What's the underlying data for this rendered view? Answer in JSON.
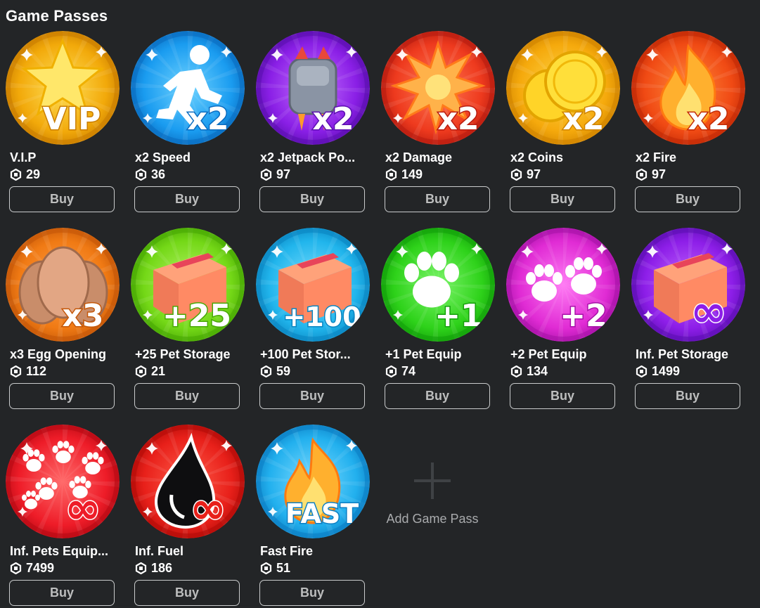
{
  "page": {
    "title": "Game Passes",
    "background": "#232527"
  },
  "passes": [
    {
      "name": "V.I.P",
      "price": "29",
      "buy_label": "Buy",
      "icon": "vip-star-icon",
      "colors": [
        "#ffe15a",
        "#f2a90a",
        "#c97d00"
      ],
      "badge": "VIP"
    },
    {
      "name": "x2 Speed",
      "price": "36",
      "buy_label": "Buy",
      "icon": "running-person-icon",
      "colors": [
        "#6fd3ff",
        "#1a9cf0",
        "#0a6cc0"
      ],
      "badge": "x2"
    },
    {
      "name": "x2 Jetpack Po...",
      "price": "97",
      "buy_label": "Buy",
      "icon": "jetpack-icon",
      "colors": [
        "#c574ff",
        "#8a1fe6",
        "#5b0fb0"
      ],
      "badge": "x2"
    },
    {
      "name": "x2 Damage",
      "price": "149",
      "buy_label": "Buy",
      "icon": "explosion-icon",
      "colors": [
        "#ff7a55",
        "#ee3a1e",
        "#b81c10"
      ],
      "badge": "x2"
    },
    {
      "name": "x2 Coins",
      "price": "97",
      "buy_label": "Buy",
      "icon": "coins-icon",
      "colors": [
        "#ffd84a",
        "#f5a90c",
        "#d08400"
      ],
      "badge": "x2"
    },
    {
      "name": "x2 Fire",
      "price": "97",
      "buy_label": "Buy",
      "icon": "fire-icon",
      "colors": [
        "#ff8a3c",
        "#f04a14",
        "#c22a06"
      ],
      "badge": "x2"
    },
    {
      "name": "x3 Egg Opening",
      "price": "112",
      "buy_label": "Buy",
      "icon": "eggs-icon",
      "colors": [
        "#ffa24d",
        "#f07a14",
        "#c45708"
      ],
      "badge": "x3"
    },
    {
      "name": "+25 Pet Storage",
      "price": "21",
      "buy_label": "Buy",
      "icon": "box-icon",
      "colors": [
        "#b6f56a",
        "#74d817",
        "#48a804"
      ],
      "badge": "+25"
    },
    {
      "name": "+100 Pet Stor...",
      "price": "59",
      "buy_label": "Buy",
      "icon": "box-icon",
      "colors": [
        "#7fe0ff",
        "#21b5ec",
        "#0a86c2"
      ],
      "badge": "+100"
    },
    {
      "name": "+1 Pet Equip",
      "price": "74",
      "buy_label": "Buy",
      "icon": "paw-icon",
      "colors": [
        "#7cf56a",
        "#2ed21a",
        "#13a00a"
      ],
      "badge": "+1"
    },
    {
      "name": "+2 Pet Equip",
      "price": "134",
      "buy_label": "Buy",
      "icon": "paws-icon",
      "colors": [
        "#ff7cf4",
        "#e02bd4",
        "#a812a8"
      ],
      "badge": "+2"
    },
    {
      "name": "Inf. Pet Storage",
      "price": "1499",
      "buy_label": "Buy",
      "icon": "box-icon",
      "colors": [
        "#c46bff",
        "#8d1ee8",
        "#5e0fb4"
      ],
      "badge": "∞"
    },
    {
      "name": "Inf. Pets Equip...",
      "price": "7499",
      "buy_label": "Buy",
      "icon": "many-paws-icon",
      "colors": [
        "#ff6a6a",
        "#ee1c28",
        "#b80a14"
      ],
      "badge": "∞"
    },
    {
      "name": "Inf. Fuel",
      "price": "186",
      "buy_label": "Buy",
      "icon": "oil-drop-icon",
      "colors": [
        "#ff5c4a",
        "#e8201a",
        "#b40c08"
      ],
      "badge": "∞"
    },
    {
      "name": "Fast Fire",
      "price": "51",
      "buy_label": "Buy",
      "icon": "fire-icon",
      "colors": [
        "#7fdcff",
        "#22b0ee",
        "#0c7fc4"
      ],
      "badge": "FAST"
    }
  ],
  "add_pass": {
    "label": "Add Game Pass",
    "icon": "plus-icon"
  }
}
